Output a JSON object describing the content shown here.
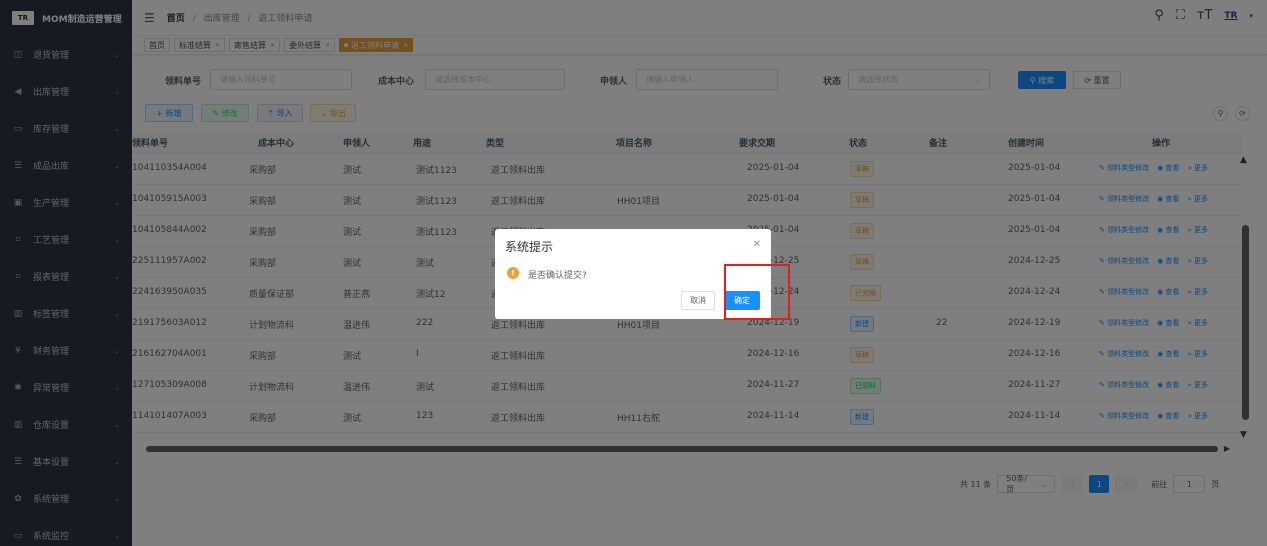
{
  "brand": {
    "logo_text": "TR",
    "title": "MOM制造运营管理"
  },
  "sidebar": {
    "items": [
      {
        "icon": "◫",
        "label": "退货管理",
        "icon_name": "return-icon"
      },
      {
        "icon": "◀",
        "label": "出库管理",
        "icon_name": "send-icon"
      },
      {
        "icon": "▭",
        "label": "库存管理",
        "icon_name": "inventory-icon"
      },
      {
        "icon": "☰",
        "label": "成品出库",
        "icon_name": "list-icon"
      },
      {
        "icon": "▣",
        "label": "生产管理",
        "icon_name": "production-icon"
      },
      {
        "icon": "⌗",
        "label": "工艺管理",
        "icon_name": "process-icon"
      },
      {
        "icon": "⌗",
        "label": "报表管理",
        "icon_name": "report-icon"
      },
      {
        "icon": "▥",
        "label": "标签管理",
        "icon_name": "label-icon"
      },
      {
        "icon": "¥",
        "label": "财务管理",
        "icon_name": "finance-icon"
      },
      {
        "icon": "✱",
        "label": "异常管理",
        "icon_name": "exception-icon"
      },
      {
        "icon": "▥",
        "label": "仓库设置",
        "icon_name": "warehouse-icon"
      },
      {
        "icon": "☰",
        "label": "基本设置",
        "icon_name": "settings-list-icon"
      },
      {
        "icon": "✿",
        "label": "系统管理",
        "icon_name": "gear-icon"
      },
      {
        "icon": "▭",
        "label": "系统监控",
        "icon_name": "monitor-icon"
      }
    ]
  },
  "header": {
    "breadcrumb": {
      "home": "首页",
      "sep": "/",
      "level1": "出库管理",
      "level2": "返工领料申请"
    },
    "icons": {
      "search": "⚲",
      "fullscreen": "⛶",
      "font_size": "ᴛT",
      "logo": "TR"
    }
  },
  "tags": [
    {
      "label": "首页",
      "closable": false,
      "active": false
    },
    {
      "label": "标准结算",
      "closable": true,
      "active": false
    },
    {
      "label": "寄售结算",
      "closable": true,
      "active": false
    },
    {
      "label": "委外结算",
      "closable": true,
      "active": false
    },
    {
      "label": "返工领料申请",
      "closable": true,
      "active": true
    }
  ],
  "search": {
    "fields": [
      {
        "label": "领料单号",
        "placeholder": "请输入领料单号"
      },
      {
        "label": "成本中心",
        "placeholder": "请选择成本中心"
      },
      {
        "label": "申领人",
        "placeholder": "请输入申领人"
      },
      {
        "label": "状态",
        "placeholder": "请选择状态"
      }
    ],
    "search_btn": "⚲ 搜索",
    "reset_btn": "⟳ 重置"
  },
  "toolbar": {
    "add": "+ 新增",
    "edit": "✎ 修改",
    "import": "⇡ 导入",
    "export": "⇣ 导出",
    "search_toggle": "⚲",
    "refresh": "⟳"
  },
  "table": {
    "columns": [
      "领料单号",
      "成本中心",
      "申领人",
      "用途",
      "类型",
      "项目名称",
      "要求交期",
      "状态",
      "备注",
      "创建时间",
      "操作"
    ],
    "rows": [
      {
        "no": "104110354A004",
        "center": "采购部",
        "person": "测试",
        "purpose": "测试1123",
        "type": "返工领料出库",
        "project": "",
        "due": "2025-01-04",
        "status": "草稿",
        "status_kind": "warn",
        "remark": "",
        "created": "2025-01-04"
      },
      {
        "no": "104105915A003",
        "center": "采购部",
        "person": "测试",
        "purpose": "测试1123",
        "type": "返工领料出库",
        "project": "HH01项目",
        "due": "2025-01-04",
        "status": "草稿",
        "status_kind": "warn",
        "remark": "",
        "created": "2025-01-04"
      },
      {
        "no": "104105844A002",
        "center": "采购部",
        "person": "测试",
        "purpose": "测试1123",
        "type": "返工领料出库",
        "project": "",
        "due": "2025-01-04",
        "status": "草稿",
        "status_kind": "warn",
        "remark": "",
        "created": "2025-01-04"
      },
      {
        "no": "225111957A002",
        "center": "采购部",
        "person": "测试",
        "purpose": "测试",
        "type": "返工领料出库",
        "project": "",
        "due": "2024-12-25",
        "status": "草稿",
        "status_kind": "warn",
        "remark": "",
        "created": "2024-12-25"
      },
      {
        "no": "224163950A035",
        "center": "质量保证部",
        "person": "普正燕",
        "purpose": "测试12",
        "type": "返工领料出库",
        "project": "",
        "due": "2024-12-24",
        "status": "已完结",
        "status_kind": "warn",
        "remark": "",
        "created": "2024-12-24"
      },
      {
        "no": "219175603A012",
        "center": "计划物流科",
        "person": "温进伟",
        "purpose": "222",
        "type": "返工领料出库",
        "project": "HH01项目",
        "due": "2024-12-19",
        "status": "新建",
        "status_kind": "new",
        "remark": "22",
        "created": "2024-12-19"
      },
      {
        "no": "216162704A001",
        "center": "采购部",
        "person": "测试",
        "purpose": "l",
        "type": "返工领料出库",
        "project": "",
        "due": "2024-12-16",
        "status": "草稿",
        "status_kind": "warn",
        "remark": "",
        "created": "2024-12-16"
      },
      {
        "no": "127105309A008",
        "center": "计划物流科",
        "person": "温进伟",
        "purpose": "测试",
        "type": "返工领料出库",
        "project": "",
        "due": "2024-11-27",
        "status": "已领料",
        "status_kind": "ok",
        "remark": "",
        "created": "2024-11-27"
      },
      {
        "no": "114101407A003",
        "center": "采购部",
        "person": "测试",
        "purpose": "123",
        "type": "返工领料出库",
        "project": "HH11右舵",
        "due": "2024-11-14",
        "status": "新建",
        "status_kind": "new",
        "remark": "",
        "created": "2024-11-14"
      }
    ],
    "ops": {
      "edit_type": "✎ 领料类型修改",
      "view": "◉ 查看",
      "more": "» 更多"
    }
  },
  "pagination": {
    "total": "共 11 条",
    "page_size": "50条/页",
    "current_page": "1",
    "goto_label": "前往",
    "goto_value": "1",
    "page_suffix": "页"
  },
  "dialog": {
    "title": "系统提示",
    "message": "是否确认提交?",
    "cancel": "取消",
    "confirm": "确定",
    "warning_glyph": "!"
  }
}
